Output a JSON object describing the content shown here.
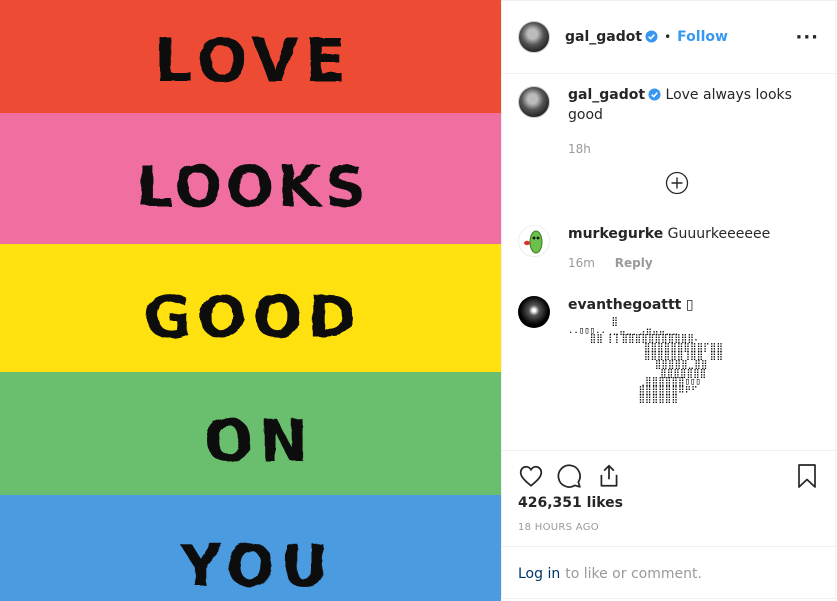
{
  "image": {
    "lines": [
      "LOVE",
      "LOOKS",
      "GOOD",
      "ON",
      "YOU"
    ],
    "stripe_colors": [
      "#ee4b34",
      "#f06fa0",
      "#ffe10f",
      "#6abf6e",
      "#4a9be0"
    ]
  },
  "header": {
    "username": "gal_gadot",
    "dot": "•",
    "follow_label": "Follow",
    "more_label": "···"
  },
  "caption": {
    "username": "gal_gadot",
    "text": "Love always looks good",
    "time": "18h"
  },
  "load_more_icon": "plus-circle-icon",
  "comments": [
    {
      "username": "murkegurke",
      "text": "Guuurkeeeeee",
      "time": "16m",
      "reply_label": "Reply"
    },
    {
      "username": "evanthegoattt",
      "text": "▯",
      "art": "        ⣿\n..▯▯▯..⢀⣀⣤⣀⡀⣠⣶⣤⣤⣀⣀\n    ⣿⣿ ⡇⡇⣿⣿⣿⣿⣿⣿⣿⣿⣿⣿⣿⠄\n              ⣿⣿⣿⣿⣿⣿⣿⣿⣿⡏⣿⣿\n              ⣿⣿⣿⣿⣿⣿⢸⣿⣿⠀⣿⣿\n                ⣿⣿⣿⣿⣿⣀⣿⣿\n                 ⣿⣿⣿⣿⣿⣿⣿\n             ⢀⣿⣿⣿⣿⣿⣿▯▯▯\n             ⣿⣿⣿⣿⣿⣿⠿⠟⠋\n             ⣿⣿⣿⣿⣿⣿"
    }
  ],
  "actions": {
    "likes": "426,351 likes",
    "time": "18 HOURS AGO"
  },
  "login": {
    "link": "Log in",
    "text": "to like or comment."
  },
  "colors": {
    "accent": "#3897f0",
    "verified": "#3897f0",
    "muted": "#999999"
  }
}
